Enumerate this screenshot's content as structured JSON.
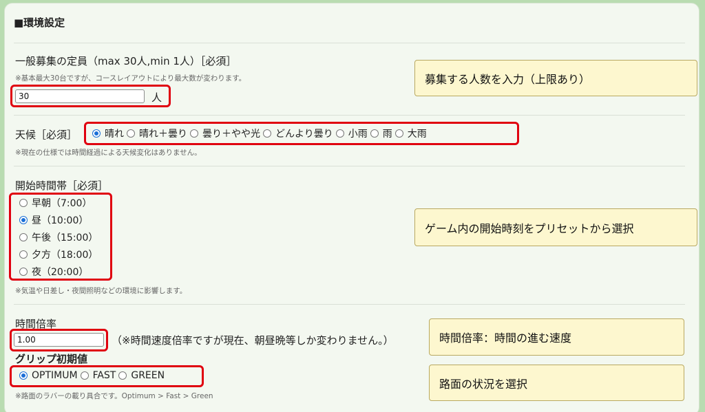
{
  "section_title": "■環境設定",
  "players": {
    "label": "一般募集の定員（max 30人,min 1人）［必須］",
    "note": "※基本最大30台ですが、コースレイアウトにより最大数が変わります。",
    "value": "30",
    "unit": "人"
  },
  "weather": {
    "label": "天候［必須］",
    "options": [
      "晴れ",
      "晴れ＋曇り",
      "曇り＋やや光",
      "どんより曇り",
      "小雨",
      "雨",
      "大雨"
    ],
    "selected_index": 0,
    "note": "※現在の仕様では時間経過による天候変化はありません。"
  },
  "start_time": {
    "label": "開始時間帯［必須］",
    "options": [
      "早朝（7:00）",
      "昼（10:00）",
      "午後（15:00）",
      "夕方（18:00）",
      "夜（20:00）"
    ],
    "selected_index": 1,
    "note": "※気温や日差し・夜間照明などの環境に影響します。"
  },
  "time_rate": {
    "label": "時間倍率",
    "value": "1.00",
    "note": "（※時間速度倍率ですが現在、朝昼晩等しか変わりません。）"
  },
  "grip": {
    "label": "グリップ初期値",
    "options": [
      "OPTIMUM",
      "FAST",
      "GREEN"
    ],
    "selected_index": 0,
    "note": "※路面のラバーの載り具合です。Optimum > Fast > Green"
  },
  "callouts": {
    "players": "募集する人数を入力（上限あり）",
    "start_time": "ゲーム内の開始時刻をプリセットから選択",
    "time_rate": "時間倍率：時間の進む速度",
    "grip": "路面の状況を選択"
  }
}
